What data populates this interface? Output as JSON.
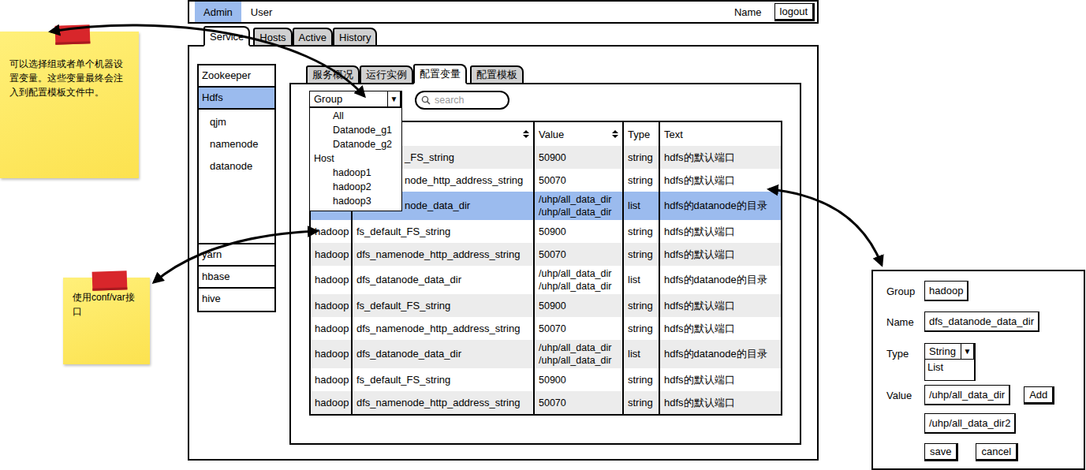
{
  "top_bar": {
    "nav": [
      {
        "label": "Admin",
        "selected": true
      },
      {
        "label": "User",
        "selected": false
      }
    ],
    "user": "Name",
    "logout": "logout"
  },
  "tabs": [
    {
      "label": "Service",
      "selected": true
    },
    {
      "label": "Hosts",
      "selected": false
    },
    {
      "label": "Active",
      "selected": false
    },
    {
      "label": "History",
      "selected": false
    }
  ],
  "sidebar": {
    "items": [
      {
        "label": "Zookeeper",
        "selected": false,
        "children": []
      },
      {
        "label": "Hdfs",
        "selected": true,
        "children": [
          {
            "label": "qjm",
            "selected": false
          },
          {
            "label": "namenode",
            "selected": false
          },
          {
            "label": "datanode",
            "selected": false
          }
        ]
      },
      {
        "label": "yarn",
        "selected": false,
        "children": []
      },
      {
        "label": "hbase",
        "selected": false,
        "children": []
      },
      {
        "label": "hive",
        "selected": false,
        "children": []
      }
    ]
  },
  "inner_tabs": [
    {
      "label": "服务概况",
      "selected": false
    },
    {
      "label": "运行实例",
      "selected": false
    },
    {
      "label": "配置变量",
      "selected": true
    },
    {
      "label": "配置模板",
      "selected": false
    }
  ],
  "filter": {
    "label": "Group",
    "arrow": "▼",
    "open": true,
    "menu": [
      {
        "label": "All",
        "kind": "option",
        "selected": false
      },
      {
        "label": "Datanode_g1",
        "kind": "option",
        "selected": false
      },
      {
        "label": "Datanode_g2",
        "kind": "option",
        "selected": false
      },
      {
        "label": "Host",
        "kind": "header",
        "selected": false
      },
      {
        "label": "hadoop1",
        "kind": "option",
        "selected": false
      },
      {
        "label": "hadoop2",
        "kind": "option",
        "selected": false
      },
      {
        "label": "hadoop3",
        "kind": "option",
        "selected": false
      }
    ]
  },
  "search": {
    "placeholder": "search"
  },
  "table": {
    "columns": [
      {
        "label": "",
        "sortable": false
      },
      {
        "label": "",
        "sortable": true
      },
      {
        "label": "Value",
        "sortable": true
      },
      {
        "label": "Type",
        "sortable": false
      },
      {
        "label": "Text",
        "sortable": false
      }
    ],
    "rows": [
      {
        "group": "",
        "name": "_FS_string",
        "value": [
          "50900"
        ],
        "type": "string",
        "text": "hdfs的默认端口",
        "selected": false
      },
      {
        "group": "",
        "name": "node_http_address_string",
        "value": [
          "50070"
        ],
        "type": "string",
        "text": "hdfs的默认端口",
        "selected": false
      },
      {
        "group": "",
        "name": "node_data_dir",
        "value": [
          "/uhp/all_data_dir",
          "/uhp/all_data_dir"
        ],
        "type": "list",
        "text": "hdfs的datanode的目录",
        "selected": true
      },
      {
        "group": "hadoop",
        "name": "fs_default_FS_string",
        "value": [
          "50900"
        ],
        "type": "string",
        "text": "hdfs的默认端口",
        "selected": false
      },
      {
        "group": "hadoop",
        "name": "dfs_namenode_http_address_string",
        "value": [
          "50070"
        ],
        "type": "string",
        "text": "hdfs的默认端口",
        "selected": false
      },
      {
        "group": "hadoop",
        "name": "dfs_datanode_data_dir",
        "value": [
          "/uhp/all_data_dir",
          "/uhp/all_data_dir"
        ],
        "type": "list",
        "text": "hdfs的datanode的目录",
        "selected": false
      },
      {
        "group": "hadoop",
        "name": "fs_default_FS_string",
        "value": [
          "50900"
        ],
        "type": "string",
        "text": "hdfs的默认端口",
        "selected": false
      },
      {
        "group": "hadoop",
        "name": "dfs_namenode_http_address_string",
        "value": [
          "50070"
        ],
        "type": "string",
        "text": "hdfs的默认端口",
        "selected": false
      },
      {
        "group": "hadoop",
        "name": "dfs_datanode_data_dir",
        "value": [
          "/uhp/all_data_dir",
          "/uhp/all_data_dir"
        ],
        "type": "list",
        "text": "hdfs的datanode的目录",
        "selected": false
      },
      {
        "group": "hadoop",
        "name": "fs_default_FS_string",
        "value": [
          "50900"
        ],
        "type": "string",
        "text": "hdfs的默认端口",
        "selected": false
      },
      {
        "group": "hadoop",
        "name": "dfs_namenode_http_address_string",
        "value": [
          "50070"
        ],
        "type": "string",
        "text": "hdfs的默认端口",
        "selected": false
      }
    ]
  },
  "notes": [
    {
      "text": "可以选择组或者单个机器设置变量。这些变量最终会注入到配置模板文件中。"
    },
    {
      "text": "使用conf/var接口"
    }
  ],
  "edit_form": {
    "group": {
      "label": "Group",
      "value": "hadoop"
    },
    "name": {
      "label": "Name",
      "value": "dfs_datanode_data_dir"
    },
    "type": {
      "label": "Type",
      "value": "String",
      "arrow": "▼",
      "open": true,
      "options": [
        "List"
      ]
    },
    "value": {
      "label": "Value",
      "values": [
        "/uhp/all_data_dir",
        "/uhp/all_data_dir2"
      ],
      "add": "Add"
    },
    "buttons": [
      "save",
      "cancel"
    ]
  }
}
